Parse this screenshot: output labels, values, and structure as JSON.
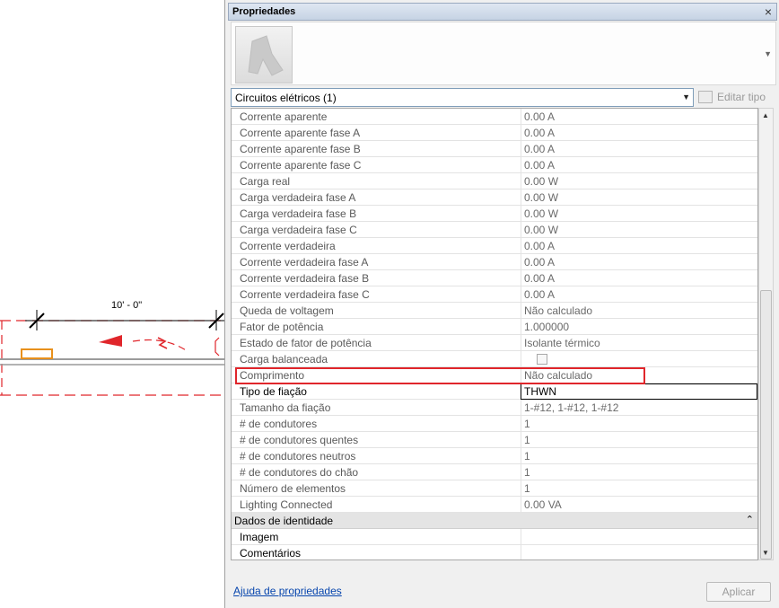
{
  "canvas": {
    "dimension_label": "10' - 0\""
  },
  "panel": {
    "title": "Propriedades",
    "close_glyph": "×",
    "type_selector": {
      "value": "Circuitos elétricos (1)"
    },
    "edit_type_label": "Editar tipo",
    "rows": [
      {
        "name": "Corrente aparente",
        "value": "0.00 A"
      },
      {
        "name": "Corrente aparente fase A",
        "value": "0.00 A"
      },
      {
        "name": "Corrente aparente fase B",
        "value": "0.00 A"
      },
      {
        "name": "Corrente aparente fase C",
        "value": "0.00 A"
      },
      {
        "name": "Carga real",
        "value": "0.00 W"
      },
      {
        "name": "Carga verdadeira fase A",
        "value": "0.00 W"
      },
      {
        "name": "Carga verdadeira fase B",
        "value": "0.00 W"
      },
      {
        "name": "Carga verdadeira fase C",
        "value": "0.00 W"
      },
      {
        "name": "Corrente verdadeira",
        "value": "0.00 A"
      },
      {
        "name": "Corrente verdadeira fase A",
        "value": "0.00 A"
      },
      {
        "name": "Corrente verdadeira fase B",
        "value": "0.00 A"
      },
      {
        "name": "Corrente verdadeira fase C",
        "value": "0.00 A"
      },
      {
        "name": "Queda de voltagem",
        "value": "Não calculado"
      },
      {
        "name": "Fator de potência",
        "value": "1.000000"
      },
      {
        "name": "Estado de fator de potência",
        "value": "Isolante térmico"
      },
      {
        "name": "Carga balanceada",
        "value": ""
      },
      {
        "name": "Comprimento",
        "value": "Não calculado"
      },
      {
        "name": "Tipo de fiação",
        "value": "THWN"
      },
      {
        "name": "Tamanho da fiação",
        "value": "1-#12, 1-#12, 1-#12"
      },
      {
        "name": "# de condutores",
        "value": "1"
      },
      {
        "name": "# de condutores quentes",
        "value": "1"
      },
      {
        "name": "# de condutores neutros",
        "value": "1"
      },
      {
        "name": "# de condutores do chão",
        "value": "1"
      },
      {
        "name": "Número de elementos",
        "value": "1"
      },
      {
        "name": "Lighting Connected",
        "value": "0.00 VA"
      }
    ],
    "section": {
      "name": "Dados de identidade",
      "toggle": "⌃"
    },
    "section_rows": [
      {
        "name": "Imagem",
        "value": ""
      },
      {
        "name": "Comentários",
        "value": ""
      }
    ],
    "help_link": "Ajuda de propriedades",
    "apply_button": "Aplicar"
  },
  "colors": {
    "highlight": "#e0262b",
    "dashed_boundary": "#e0262b",
    "device": "#e8901c",
    "link": "#0645ad"
  }
}
